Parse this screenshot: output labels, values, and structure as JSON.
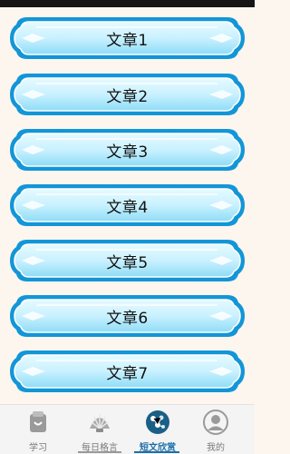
{
  "articles": [
    "文章1",
    "文章2",
    "文章3",
    "文章4",
    "文章5",
    "文章6",
    "文章7"
  ],
  "tabs": [
    {
      "label": "学习",
      "icon": "study-icon"
    },
    {
      "label": "每日格言",
      "icon": "shell-icon"
    },
    {
      "label": "短文欣赏",
      "icon": "flower-icon",
      "active": true
    },
    {
      "label": "我的",
      "icon": "profile-icon"
    }
  ],
  "colors": {
    "frame_outer": "#1296d8",
    "frame_inner": "#c9f1ff",
    "active_tab": "#1b6fa8"
  }
}
